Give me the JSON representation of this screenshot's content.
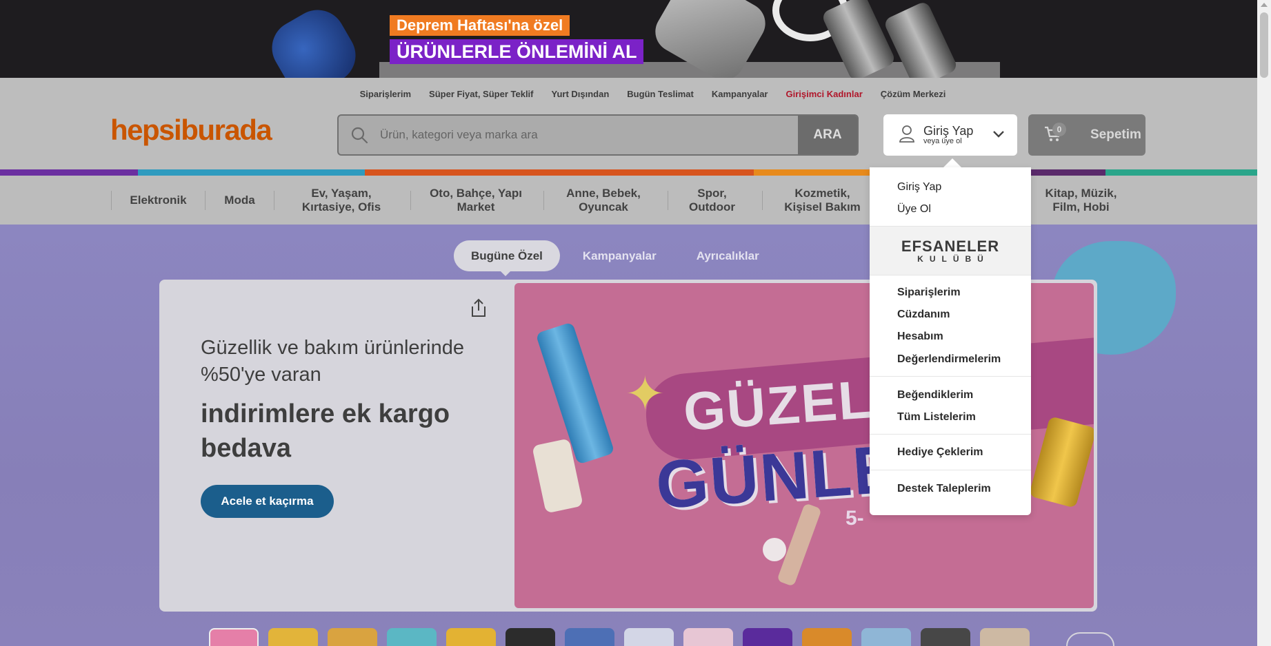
{
  "banner": {
    "line1": "Deprem Haftası'na özel",
    "line2": "ÜRÜNLERLE ÖNLEMİNİ AL"
  },
  "util_nav": [
    {
      "label": "Siparişlerim"
    },
    {
      "label": "Süper Fiyat, Süper Teklif"
    },
    {
      "label": "Yurt Dışından"
    },
    {
      "label": "Bugün Teslimat"
    },
    {
      "label": "Kampanyalar"
    },
    {
      "label": "Girişimci Kadınlar",
      "highlight": true
    },
    {
      "label": "Çözüm Merkezi"
    }
  ],
  "logo": "hepsiburada",
  "search": {
    "placeholder": "Ürün, kategori veya marka ara",
    "button": "ARA"
  },
  "login": {
    "title": "Giriş Yap",
    "subtitle": "veya üye ol"
  },
  "cart": {
    "count": "0",
    "label": "Sepetim"
  },
  "categories": [
    {
      "line1": "Elektronik",
      "line2": ""
    },
    {
      "line1": "Moda",
      "line2": ""
    },
    {
      "line1": "Ev, Yaşam,",
      "line2": "Kırtasiye, Ofis"
    },
    {
      "line1": "Oto, Bahçe, Yapı",
      "line2": "Market"
    },
    {
      "line1": "Anne, Bebek,",
      "line2": "Oyuncak"
    },
    {
      "line1": "Spor,",
      "line2": "Outdoor"
    },
    {
      "line1": "Kozmetik,",
      "line2": "Kişisel Bakım"
    },
    {
      "line1": "Kitap, Müzik,",
      "line2": "Film, Hobi"
    }
  ],
  "tabs": [
    {
      "label": "Bugüne Özel",
      "active": true
    },
    {
      "label": "Kampanyalar",
      "active": false
    },
    {
      "label": "Ayrıcalıklar",
      "active": false
    }
  ],
  "hero": {
    "text_light": "Güzellik ve bakım ürünlerinde %50'ye varan",
    "text_bold": "indirimlere ek kargo bedava",
    "cta": "Acele et kaçırma",
    "image_word1": "GÜZELLİ",
    "image_word2": "GÜNLE",
    "image_sub": "5-"
  },
  "dropdown": {
    "login": "Giriş Yap",
    "signup": "Üye Ol",
    "club_title": "EFSANELER",
    "club_sub": "KULÜBÜ",
    "orders": "Siparişlerim",
    "wallet": "Cüzdanım",
    "account": "Hesabım",
    "reviews": "Değerlendirmelerim",
    "likes": "Beğendiklerim",
    "lists": "Tüm Listelerim",
    "gift_cards": "Hediye Çeklerim",
    "support": "Destek Taleplerim"
  },
  "colors": {
    "brand": "#c95500",
    "cta": "#1b5e8c",
    "highlight_link": "#b0162a",
    "stripe": [
      "#6b2fa0",
      "#2f9bbf",
      "#d7541e",
      "#e78a1c",
      "#5a2a6b",
      "#2aa58a"
    ]
  }
}
